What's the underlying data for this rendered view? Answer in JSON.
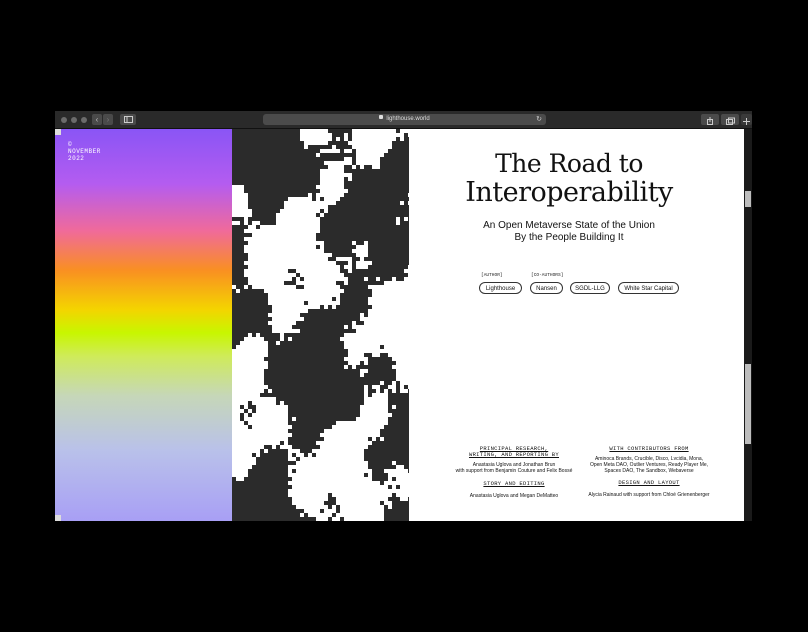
{
  "browser": {
    "url": "lighthouse.world",
    "back_label": "‹",
    "forward_label": "›"
  },
  "sidebar": {
    "date_line1": "©",
    "date_line2": "NOVEMBER",
    "date_line3": "2022"
  },
  "hero": {
    "title_line1": "The Road to",
    "title_line2": "Interoperability",
    "subtitle_line1": "An Open Metaverse State of the Union",
    "subtitle_line2": "By the People Building It"
  },
  "authors": {
    "author_label": "[AUTHOR]",
    "coauthors_label": "[CO-AUTHORS]",
    "pills": [
      "Lighthouse",
      "Nansen",
      "SGDL-LLG",
      "White Star Capital"
    ]
  },
  "credits": {
    "research_heading_line1": "PRINCIPAL RESEARCH,",
    "research_heading_line2": "WRITING, AND REPORTING BY",
    "research_text_line1": "Anastasia Uglova and Jonathan Brun",
    "research_text_line2": "with support from Benjamin Couture and Felix Bossé",
    "story_heading": "STORY AND EDITING",
    "story_text": "Anastasia Uglova and Megan DeMatteo",
    "contributors_heading": "WITH CONTRIBUTORS FROM",
    "contributors_line1": "Aminoca Brands, Crucible, Disco, Lvcidia, Mona,",
    "contributors_line2": "Open Meta DAO, Outlier Ventures, Ready Player Me,",
    "contributors_line3": "Spaces DAO, The Sandbox, Webaverse",
    "design_heading": "DESIGN AND LAYOUT",
    "design_text": "Alycia Rainaud with support from Chloé Grienenberger"
  },
  "colors": {
    "browser_chrome": "#2a2a2a",
    "gradient_top": "#8a55f5",
    "gradient_orange": "#f98f22",
    "gradient_lime": "#c8f600",
    "gradient_bottom": "#a89ff5",
    "pattern_dark": "#2b2b2b"
  }
}
